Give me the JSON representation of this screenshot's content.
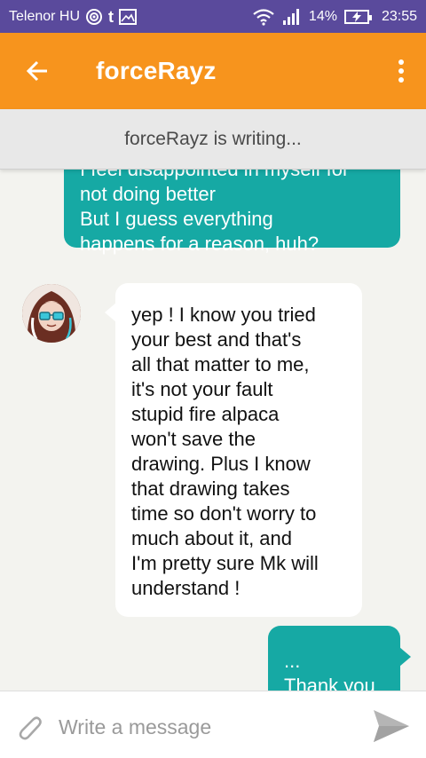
{
  "status_bar": {
    "carrier": "Telenor HU",
    "battery_percent": "14%",
    "time": "23:55"
  },
  "app_bar": {
    "title": "forceRayz"
  },
  "typing_banner": "forceRayz is writing...",
  "messages": [
    {
      "direction": "outgoing",
      "lines": [
        "I feel disappointed in myself for",
        "not doing better",
        "But I guess everything",
        "happens for a reason, huh?"
      ]
    },
    {
      "direction": "incoming",
      "lines": [
        "yep ! I know you tried",
        "your best and that's",
        "all that matter to me,",
        "it's not your fault",
        "stupid fire alpaca",
        "won't save the",
        "drawing. Plus I know",
        "that drawing takes",
        "time so don't worry to",
        "much about it, and",
        "I'm pretty sure Mk will",
        "understand !"
      ]
    },
    {
      "direction": "outgoing",
      "lines": [
        "...",
        "Thank you"
      ]
    }
  ],
  "composer": {
    "placeholder": "Write a message"
  },
  "colors": {
    "status_bar": "#5a4a9c",
    "app_bar": "#f7941d",
    "outgoing_bubble": "#16a9a4",
    "incoming_bubble": "#ffffff",
    "chat_background": "#f3f3ef"
  }
}
